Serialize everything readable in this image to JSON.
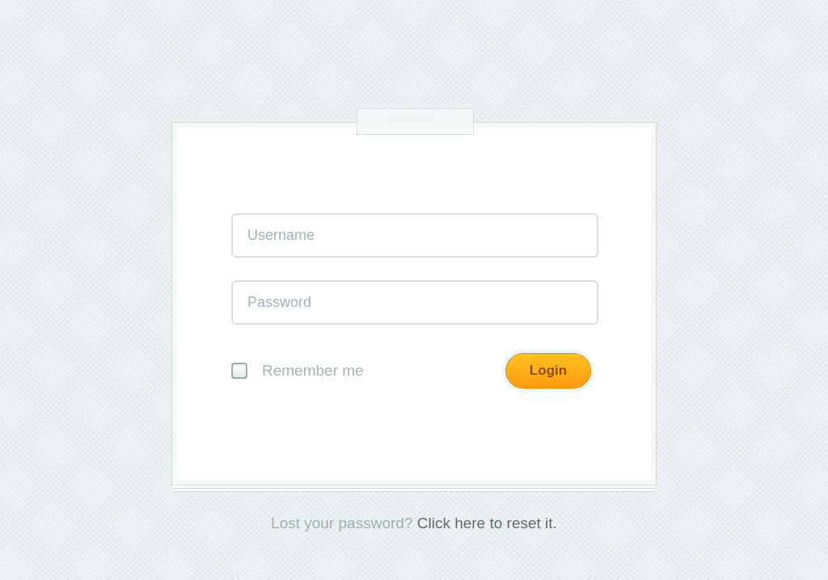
{
  "login_form": {
    "fields": [
      {
        "placeholder": "Username"
      },
      {
        "placeholder": "Password"
      }
    ],
    "remember_me": {
      "label": "Remember me",
      "checked": false
    },
    "login_button": "Login"
  },
  "footer": {
    "text": "Lost your password?",
    "link": "Click here to reset it."
  }
}
